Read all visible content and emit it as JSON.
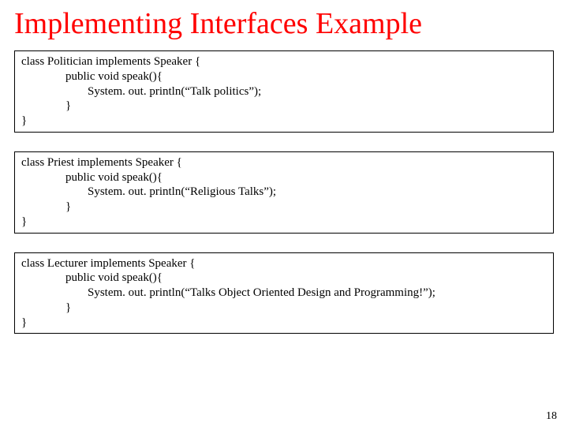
{
  "title": "Implementing Interfaces Example",
  "blocks": [
    {
      "line1": "class  Politician implements Speaker {",
      "line2": "public void speak(){",
      "line3": "System. out. println(“Talk politics”);",
      "line4": "}",
      "line5": "}"
    },
    {
      "line1": "class  Priest implements Speaker {",
      "line2": "public void speak(){",
      "line3": "System. out. println(“Religious Talks”);",
      "line4": "}",
      "line5": "}"
    },
    {
      "line1": "class  Lecturer implements Speaker {",
      "line2": "public void speak(){",
      "line3": "System. out. println(“Talks Object Oriented Design and Programming!”);",
      "line4": "}",
      "line5": "}"
    }
  ],
  "page_number": "18"
}
